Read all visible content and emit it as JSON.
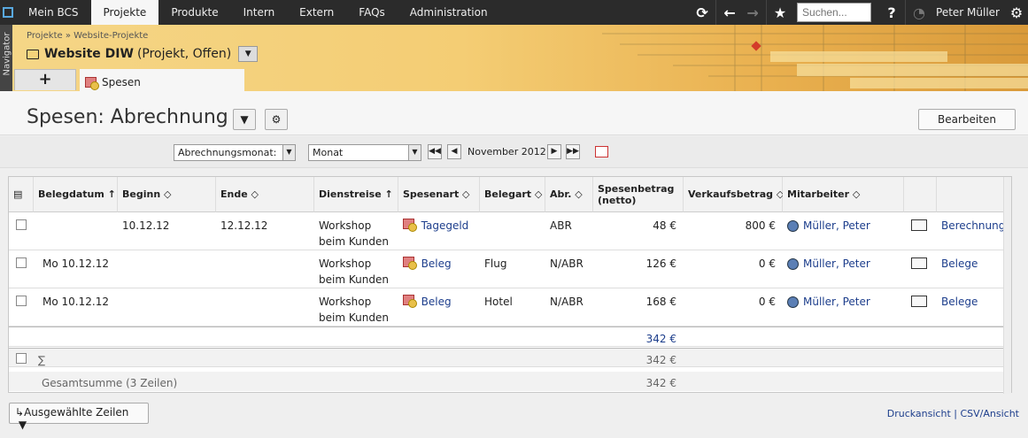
{
  "topbar": {
    "menu": [
      "Mein BCS",
      "Projekte",
      "Produkte",
      "Intern",
      "Extern",
      "FAQs",
      "Administration"
    ],
    "active_index": 1,
    "search_placeholder": "Suchen...",
    "help_label": "?",
    "user_name": "Peter Müller",
    "icons": [
      "sync-icon",
      "back-arrow-icon",
      "forward-arrow-icon",
      "star-icon",
      "stopwatch-icon",
      "gear-icon"
    ]
  },
  "navigator": {
    "label": "Navigator"
  },
  "breadcrumb": {
    "items": [
      "Projekte",
      "»",
      "Website-Projekte"
    ]
  },
  "project": {
    "name": "Website DIW",
    "meta": "(Projekt, Offen)"
  },
  "tabs": {
    "add_label": "+",
    "current_label": "Spesen"
  },
  "page": {
    "title": "Spesen: Abrechnung",
    "edit_button": "Bearbeiten"
  },
  "filter": {
    "period_select": "Abrechnungsmonat:",
    "granularity_select": "Monat",
    "current_period": "November 2012"
  },
  "table": {
    "headers": [
      "Belegdatum",
      "Beginn",
      "Ende",
      "Dienstreise",
      "Spesenart",
      "Belegart",
      "Abr.",
      "Spesenbetrag (netto)",
      "Verkaufsbetrag",
      "Mitarbeiter"
    ],
    "rows": [
      {
        "belegdatum": "",
        "beginn": "10.12.12",
        "ende": "12.12.12",
        "dienstreise": "Workshop beim Kunden",
        "spesenart": "Tagegeld",
        "belegart": "",
        "abr": "ABR",
        "betrag": "48 €",
        "verkauf": "800 €",
        "mitarbeiter": "Müller, Peter",
        "link": "Berechnung"
      },
      {
        "belegdatum": "Mo 10.12.12",
        "beginn": "",
        "ende": "",
        "dienstreise": "Workshop beim Kunden",
        "spesenart": "Beleg",
        "belegart": "Flug",
        "abr": "N/ABR",
        "betrag": "126 €",
        "verkauf": "0 €",
        "mitarbeiter": "Müller, Peter",
        "link": "Belege"
      },
      {
        "belegdatum": "Mo 10.12.12",
        "beginn": "",
        "ende": "",
        "dienstreise": "Workshop beim Kunden",
        "spesenart": "Beleg",
        "belegart": "Hotel",
        "abr": "N/ABR",
        "betrag": "168 €",
        "verkauf": "0 €",
        "mitarbeiter": "Müller, Peter",
        "link": "Belege"
      }
    ],
    "subtotal": "342 €",
    "sum_symbol": "∑",
    "sum_value": "342 €",
    "grand_total_label": "Gesamtsumme (3 Zeilen)",
    "grand_total_value": "342 €"
  },
  "footer": {
    "selected_rows_button": "Ausgewählte Zeilen",
    "print_link": "Druckansicht",
    "separator": "|",
    "csv_link": "CSV/Ansicht"
  }
}
